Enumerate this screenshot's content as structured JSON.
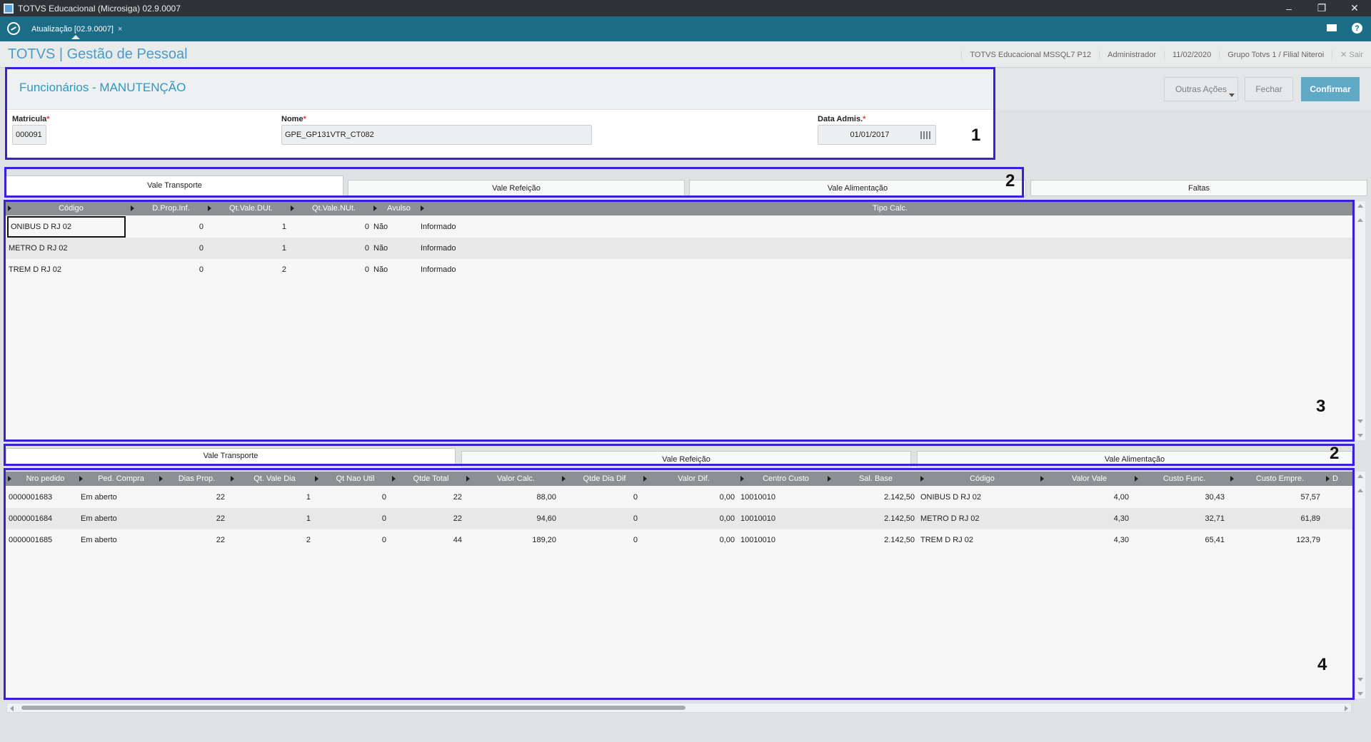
{
  "window": {
    "title": "TOTVS Educacional (Microsiga) 02.9.0007",
    "minimize": "–",
    "restore": "❐",
    "close": "✕"
  },
  "tabbar": {
    "tab_label": "Atualização [02.9.0007]",
    "tab_close": "×",
    "help": "?"
  },
  "module": {
    "brand": "TOTVS | Gestão de Pessoal",
    "env": "TOTVS Educacional MSSQL7 P12",
    "user": "Administrador",
    "date": "11/02/2020",
    "branch": "Grupo Totvs 1 / Filial Niteroi",
    "exit": "✕  Sair"
  },
  "form": {
    "title": "Funcionários - MANUTENÇÃO",
    "matricula_label": "Matricula",
    "matricula_value": "000091",
    "nome_label": "Nome",
    "nome_value": "GPE_GP131VTR_CT082",
    "data_label": "Data Admis.",
    "data_value": "01/01/2017",
    "required_mark": "*"
  },
  "actions": {
    "outras": "Outras Ações",
    "fechar": "Fechar",
    "confirmar": "Confirmar"
  },
  "top_tabs": [
    "Vale Transporte",
    "Vale Refeição",
    "Vale Alimentação",
    "Faltas"
  ],
  "grid1": {
    "columns": [
      "Código",
      "D.Prop.Inf.",
      "Qt.Vale.DUt.",
      "Qt.Vale.NUt.",
      "Avulso",
      "Tipo Calc."
    ],
    "rows": [
      [
        "ONIBUS D RJ 02",
        "0",
        "1",
        "0",
        "Não",
        "Informado"
      ],
      [
        "METRO D RJ 02",
        "0",
        "1",
        "0",
        "Não",
        "Informado"
      ],
      [
        "TREM D RJ 02",
        "0",
        "2",
        "0",
        "Não",
        "Informado"
      ]
    ]
  },
  "bottom_tabs": [
    "Vale Transporte",
    "Vale Refeição",
    "Vale Alimentação"
  ],
  "grid2": {
    "columns": [
      "Nro pedido",
      "Ped. Compra",
      "Dias Prop.",
      "Qt. Vale Dia",
      "Qt Nao Util",
      "Qtde Total",
      "Valor Calc.",
      "Qtde Dia Dif",
      "Valor Dif.",
      "Centro Custo",
      "Sal. Base",
      "Código",
      "Valor Vale",
      "Custo Func.",
      "Custo Empre.",
      "D"
    ],
    "rows": [
      [
        "0000001683",
        "Em aberto",
        "22",
        "1",
        "0",
        "22",
        "88,00",
        "0",
        "0,00",
        "10010010",
        "2.142,50",
        "ONIBUS D RJ 02",
        "4,00",
        "30,43",
        "57,57"
      ],
      [
        "0000001684",
        "Em aberto",
        "22",
        "1",
        "0",
        "22",
        "94,60",
        "0",
        "0,00",
        "10010010",
        "2.142,50",
        "METRO D RJ 02",
        "4,30",
        "32,71",
        "61,89"
      ],
      [
        "0000001685",
        "Em aberto",
        "22",
        "2",
        "0",
        "44",
        "189,20",
        "0",
        "0,00",
        "10010010",
        "2.142,50",
        "TREM D RJ 02",
        "4,30",
        "65,41",
        "123,79"
      ]
    ]
  },
  "annotations": [
    "1",
    "2",
    "3",
    "2",
    "4"
  ],
  "colors": {
    "annotation": "#3b1fd6",
    "brand": "#4b9cc4",
    "tabbar": "#1b6c86",
    "confirm": "#5fa8c6"
  }
}
